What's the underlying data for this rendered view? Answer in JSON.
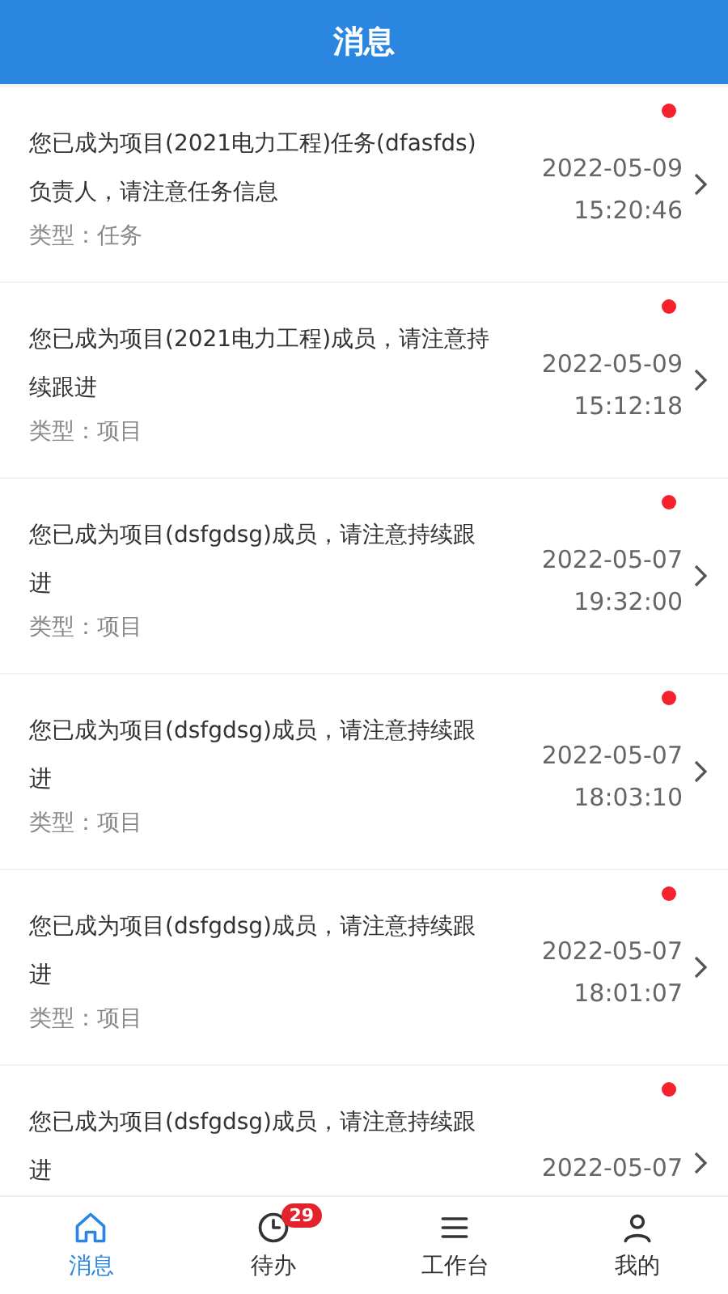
{
  "header": {
    "title": "消息"
  },
  "messages": [
    {
      "text": "您已成为项目(2021电力工程)任务(dfasfds)负责人，请注意任务信息",
      "type": "类型：任务",
      "date": "2022-05-09",
      "time": "15:20:46",
      "unread": true
    },
    {
      "text": "您已成为项目(2021电力工程)成员，请注意持续跟进",
      "type": "类型：项目",
      "date": "2022-05-09",
      "time": "15:12:18",
      "unread": true
    },
    {
      "text": "您已成为项目(dsfgdsg)成员，请注意持续跟进",
      "type": "类型：项目",
      "date": "2022-05-07",
      "time": "19:32:00",
      "unread": true
    },
    {
      "text": "您已成为项目(dsfgdsg)成员，请注意持续跟进",
      "type": "类型：项目",
      "date": "2022-05-07",
      "time": "18:03:10",
      "unread": true
    },
    {
      "text": "您已成为项目(dsfgdsg)成员，请注意持续跟进",
      "type": "类型：项目",
      "date": "2022-05-07",
      "time": "18:01:07",
      "unread": true
    },
    {
      "text": "您已成为项目(dsfgdsg)成员，请注意持续跟进",
      "date": "2022-05-07",
      "unread": true
    }
  ],
  "tabs": [
    {
      "kind": "home",
      "label": "消息",
      "selected": true
    },
    {
      "kind": "clock",
      "label": "待办",
      "selected": false,
      "badge": "29"
    },
    {
      "kind": "menu",
      "label": "工作台",
      "selected": false
    },
    {
      "kind": "person",
      "label": "我的",
      "selected": false
    }
  ]
}
